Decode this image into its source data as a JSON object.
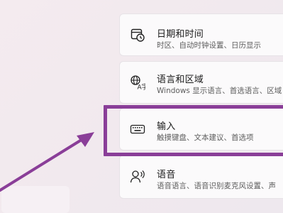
{
  "settings": {
    "items": [
      {
        "title": "日期和时间",
        "desc": "时区、自动时钟设置、日历显示",
        "icon": "clock-calendar-icon"
      },
      {
        "title": "语言和区域",
        "desc": "Windows 显示语言、首选语言、区域",
        "icon": "language-icon"
      },
      {
        "title": "输入",
        "desc": "触摸键盘、文本建议、首选项",
        "icon": "keyboard-icon"
      },
      {
        "title": "语音",
        "desc": "语音语言、语音识别麦克风设置、声",
        "icon": "speech-icon"
      }
    ]
  },
  "colors": {
    "highlight": "#8a3e98",
    "arrow": "#8a3e98"
  }
}
